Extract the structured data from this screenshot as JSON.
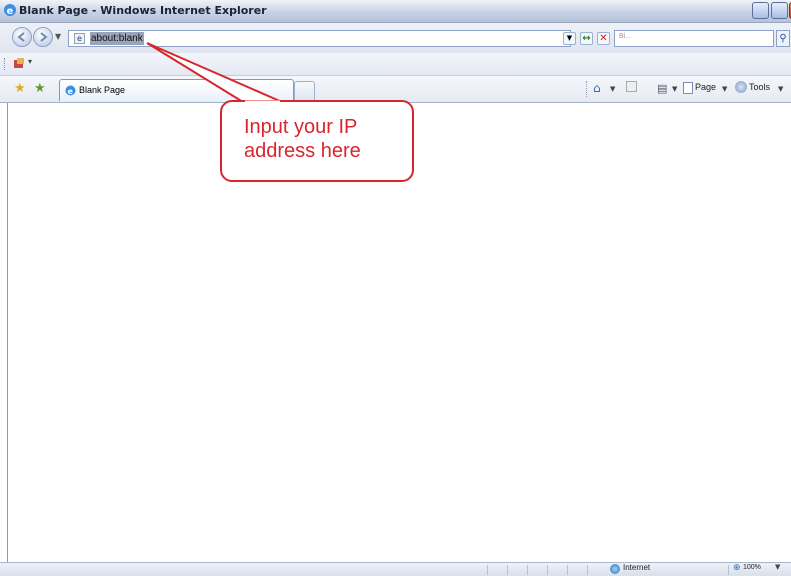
{
  "window": {
    "title": "Blank Page - Windows Internet Explorer"
  },
  "address_bar": {
    "url": "about:blank",
    "search_placeholder": "Bi..."
  },
  "tab": {
    "label": "Blank Page"
  },
  "command_bar": {
    "page_label": "Page",
    "tools_label": "Tools"
  },
  "status_bar": {
    "zone": "Internet",
    "zoom": "100%"
  },
  "callout": {
    "line1": "Input your IP",
    "line2": "address here",
    "color": "#d8262d"
  },
  "icons": [
    "ie-logo-icon",
    "back-icon",
    "forward-icon",
    "refresh-icon",
    "stop-icon",
    "search-icon",
    "favorites-star-icon",
    "add-favorites-icon",
    "home-icon",
    "feeds-icon",
    "print-icon",
    "page-icon",
    "tools-icon",
    "globe-icon",
    "zoom-icon"
  ]
}
